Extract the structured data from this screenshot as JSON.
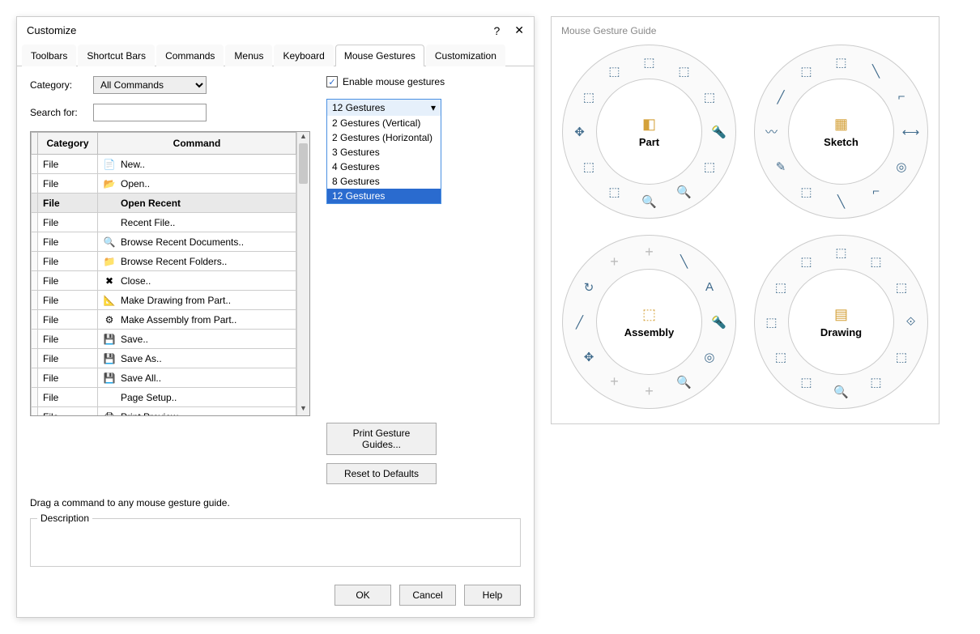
{
  "dialog": {
    "title": "Customize",
    "help_icon": "?",
    "close_icon": "✕",
    "tabs": [
      "Toolbars",
      "Shortcut Bars",
      "Commands",
      "Menus",
      "Keyboard",
      "Mouse Gestures",
      "Customization"
    ],
    "active_tab_index": 5,
    "category_label": "Category:",
    "category_value": "All Commands",
    "search_label": "Search for:",
    "search_value": "",
    "table": {
      "header_category": "Category",
      "header_command": "Command",
      "rows": [
        {
          "category": "File",
          "command": "New..",
          "icon": "📄",
          "highlight": false
        },
        {
          "category": "File",
          "command": "Open..",
          "icon": "📂",
          "highlight": false
        },
        {
          "category": "File",
          "command": "Open Recent",
          "icon": "",
          "highlight": true
        },
        {
          "category": "File",
          "command": "Recent File..",
          "icon": "",
          "highlight": false
        },
        {
          "category": "File",
          "command": "Browse Recent Documents..",
          "icon": "🔍",
          "highlight": false
        },
        {
          "category": "File",
          "command": "Browse Recent Folders..",
          "icon": "📁",
          "highlight": false
        },
        {
          "category": "File",
          "command": "Close..",
          "icon": "✖",
          "highlight": false
        },
        {
          "category": "File",
          "command": "Make Drawing from Part..",
          "icon": "📐",
          "highlight": false
        },
        {
          "category": "File",
          "command": "Make Assembly from Part..",
          "icon": "⚙",
          "highlight": false
        },
        {
          "category": "File",
          "command": "Save..",
          "icon": "💾",
          "highlight": false
        },
        {
          "category": "File",
          "command": "Save As..",
          "icon": "💾",
          "highlight": false
        },
        {
          "category": "File",
          "command": "Save All..",
          "icon": "💾",
          "highlight": false
        },
        {
          "category": "File",
          "command": "Page Setup..",
          "icon": "",
          "highlight": false
        },
        {
          "category": "File",
          "command": "Print Preview..",
          "icon": "🖨",
          "highlight": false
        }
      ]
    },
    "enable_label": "Enable mouse gestures",
    "enable_checked": true,
    "gesture_dropdown": {
      "selected": "12 Gestures",
      "options": [
        "2 Gestures (Vertical)",
        "2 Gestures (Horizontal)",
        "3 Gestures",
        "4 Gestures",
        "8 Gestures",
        "12 Gestures"
      ],
      "highlighted_index": 5
    },
    "print_button": "Print Gesture Guides...",
    "reset_button": "Reset to Defaults",
    "hint": "Drag a command to any mouse gesture guide.",
    "description_label": "Description",
    "ok_button": "OK",
    "cancel_button": "Cancel",
    "help_button": "Help"
  },
  "guide": {
    "title": "Mouse Gesture Guide",
    "wheels": [
      {
        "label": "Part",
        "center_icon": "◧",
        "slots": [
          "⬚",
          "⬚",
          "⬚",
          "🔦",
          "⬚",
          "🔍",
          "🔍",
          "⬚",
          "⬚",
          "✥",
          "⬚",
          "⬚"
        ],
        "placeholders": []
      },
      {
        "label": "Sketch",
        "center_icon": "▦",
        "slots": [
          "⬚",
          "╲",
          "⌐",
          "⟷",
          "◎",
          "⌐",
          "╲",
          "⬚",
          "✎",
          "〰",
          "╱",
          "⬚"
        ],
        "placeholders": []
      },
      {
        "label": "Assembly",
        "center_icon": "⬚",
        "slots": [
          "+",
          "╲",
          "A",
          "🔦",
          "◎",
          "🔍",
          "+",
          "+",
          "✥",
          "╱",
          "↻",
          "+"
        ],
        "placeholders": [
          0,
          6,
          7,
          11
        ]
      },
      {
        "label": "Drawing",
        "center_icon": "▤",
        "slots": [
          "⬚",
          "⬚",
          "⬚",
          "⟐",
          "⬚",
          "⬚",
          "🔍",
          "⬚",
          "⬚",
          "⬚",
          "⬚",
          "⬚"
        ],
        "placeholders": []
      }
    ]
  }
}
